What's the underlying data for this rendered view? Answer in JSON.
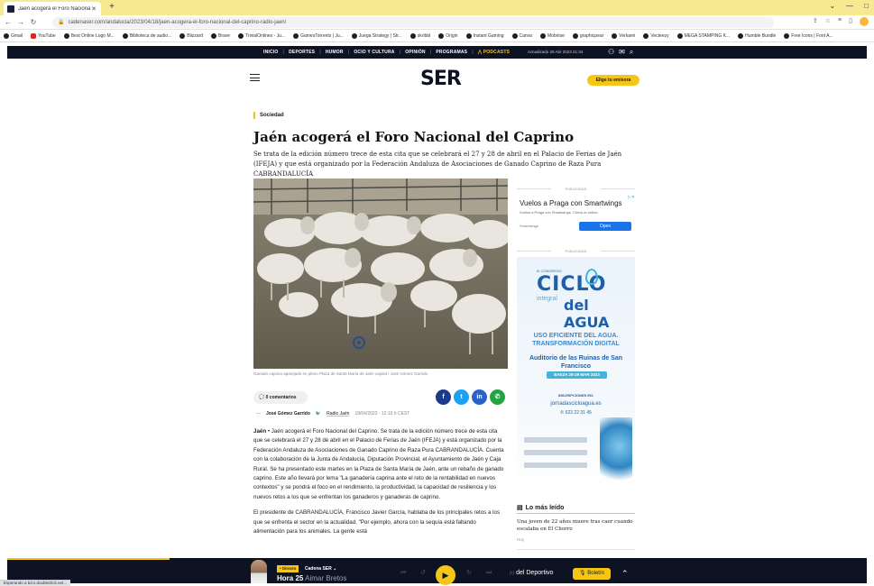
{
  "browser": {
    "tab_title": "Jaén acogerá el Foro Nacional d",
    "new_tab": "+",
    "url": "cadenaser.com/andalucia/2023/04/18/jaen-acogera-el-foro-nacional-del-caprino-radio-jaen/",
    "bookmarks": [
      "Gmail",
      "YouTube",
      "Best Online Logo M...",
      "Biblioteca de audio...",
      "Blizzard",
      "Brave",
      "TrivialOnlines - Ju...",
      "GamesTorrents | Ju...",
      "Juega Strategy | Str...",
      "skribbl",
      "Origin",
      "Instant Gaming",
      "Canva",
      "Mobirise",
      "graphicpear",
      "Verkami",
      "Vecteezy",
      "MEGA STAMPING K...",
      "Humble Bundle",
      "Free Icons | Font A..."
    ],
    "status_text": "Esperando a bd.s.doubleclick.net..."
  },
  "site_nav": {
    "items": [
      "INICIO",
      "DEPORTES",
      "HUMOR",
      "OCIO Y CULTURA",
      "OPINIÓN",
      "PROGRAMAS"
    ],
    "podcasts": "PODCASTS",
    "updated": "Actualizado 20 Abr 2023 21:34"
  },
  "header": {
    "logo": "SER",
    "elige_label": "Elige tu emisora"
  },
  "article": {
    "section": "Sociedad",
    "headline": "Jaén acogerá el Foro Nacional del Caprino",
    "subtitle": "Se trata de la edición número trece de esta cita que se celebrará el 27 y 28 de abril en el Palacio de Ferias de Jaén (IFEJA) y que está organizado por la Federación Andaluza de Asociaciones de Ganado Caprino de Raza Pura CABRANDALUCÍA",
    "photo_caption": "Ganado caprino aparejado en pleno Plaza de Santa María de Jaén capital / José Gómez Garrido",
    "comments": "0 comentarios",
    "author": "José Gómez Garrido",
    "radio": "Radio Jaén",
    "date": "18/04/2023 - 12:10 h CEST",
    "paragraph1_lead": "Jaén",
    "paragraph1": " • Jaén acogerá el Foro Nacional del Caprino. Se trata de la edición número trece de esta cita que se celebrará el 27 y 28 de abril en el Palacio de Ferias de Jaén (IFEJA) y está organizado por la Federación Andaluza de Asociaciones de Ganado Caprino de Raza Pura CABRANDALUCÍA. Cuenta con la colaboración de la Junta de Andalucía, Diputación Provincial, el Ayuntamiento de Jaén y Caja Rural. Se ha presentado este martes en la Plaza de Santa María de Jaén, ante un rebaño de ganado caprino. Este año llevará por lema \"La ganadería caprina ante el reto de la rentabilidad en nuevos contextos\" y se pondrá el foco en el rendimiento, la productividad, la capacidad de resiliencia y los nuevos retos a los que se enfrentan los ganaderos y ganaderas de caprino.",
    "paragraph2": "El presidente de CABRANDALUCÍA, Francisco Javier García, hablaba de los principales retos a los que se enfrenta el sector en la actualidad. \"Por ejemplo, ahora con la sequía está faltando alimentación para los animales. La gente está"
  },
  "sidebar": {
    "pub_label": "PUBLICIDAD",
    "ad1": {
      "title": "Vuelos a Praga con Smartwings",
      "subtitle": "Vuelos a Praga con Smartwings. Check-in online.",
      "brand": "Smartwings",
      "open": "Open"
    },
    "ad2": {
      "congreso": "III CONGRESO",
      "ciclo": "CICLO",
      "integral": "integral",
      "agua": "del AGUA",
      "uso": "USO EFICIENTE DEL AGUA. TRANSFORMACIÓN DIGITAL",
      "auditorio": "Auditorio de las Ruinas de San Francisco",
      "date": "BAEZA 28-29 MAR 2023",
      "inscripciones": "INSCRIPCIONES EN:",
      "site": "jornadascicloagua.es",
      "phone": "623 22 31 45"
    },
    "lomas_title": "Lo más leído",
    "lomas_item": "Una joven de 22 años muere tras caer cuando escalaba en El Chorro",
    "lomas_time": "Hoy"
  },
  "player": {
    "directo": "• Directo",
    "station": "Cadena SER ⌄",
    "show_hour": "Hora 25",
    "show_host": "Aimar Bretos",
    "deportivo": "del Deportivo",
    "boletin": "Boletín"
  },
  "colors": {
    "brand_dark": "#0e1324",
    "accent_yellow": "#f5c518",
    "facebook": "#1b3a8a",
    "twitter": "#1da1f2",
    "linkedin": "#2a63c6",
    "whatsapp": "#25a244"
  }
}
